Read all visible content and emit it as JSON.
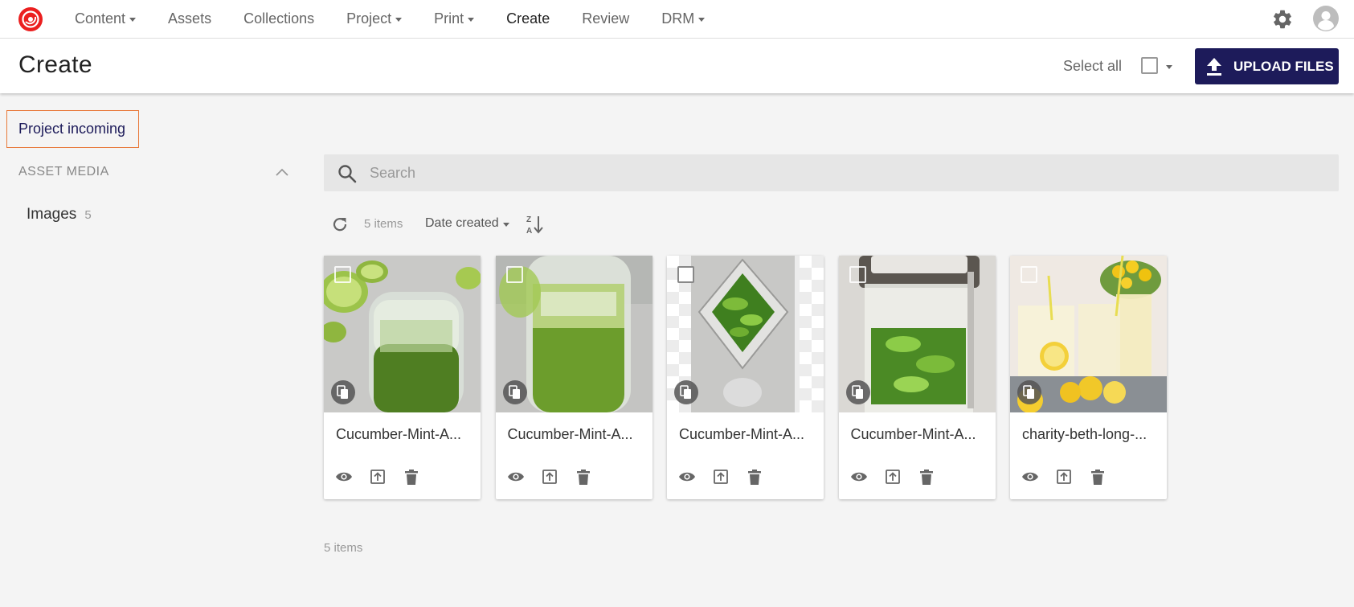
{
  "nav": {
    "items": [
      {
        "label": "Content",
        "dropdown": true,
        "active": false
      },
      {
        "label": "Assets",
        "dropdown": false,
        "active": false
      },
      {
        "label": "Collections",
        "dropdown": false,
        "active": false
      },
      {
        "label": "Project",
        "dropdown": true,
        "active": false
      },
      {
        "label": "Print",
        "dropdown": true,
        "active": false
      },
      {
        "label": "Create",
        "dropdown": false,
        "active": true
      },
      {
        "label": "Review",
        "dropdown": false,
        "active": false
      },
      {
        "label": "DRM",
        "dropdown": true,
        "active": false
      }
    ],
    "icons": {
      "logo": "sitecore-logo-icon",
      "settings": "gear-icon",
      "user": "user-avatar-icon"
    }
  },
  "header": {
    "title": "Create",
    "select_all_label": "Select all",
    "upload_label": "UPLOAD FILES"
  },
  "sidebar": {
    "project_label": "Project incoming",
    "section_label": "ASSET MEDIA",
    "images_label": "Images",
    "images_count": "5"
  },
  "search": {
    "placeholder": "Search",
    "value": ""
  },
  "toolbar": {
    "count_label": "5 items",
    "sort_label": "Date created"
  },
  "cards": [
    {
      "name": "Cucumber-Mint-A...",
      "thumb": "jar-limes"
    },
    {
      "name": "Cucumber-Mint-A...",
      "thumb": "jar-green"
    },
    {
      "name": "Cucumber-Mint-A...",
      "thumb": "blender-top"
    },
    {
      "name": "Cucumber-Mint-A...",
      "thumb": "blender-side"
    },
    {
      "name": "charity-beth-long-...",
      "thumb": "lemonade"
    }
  ],
  "footer": {
    "count_label": "5 items"
  },
  "colors": {
    "brand": "#eb1f1f",
    "primary": "#1d1b5a",
    "accent_border": "#e8793a"
  }
}
